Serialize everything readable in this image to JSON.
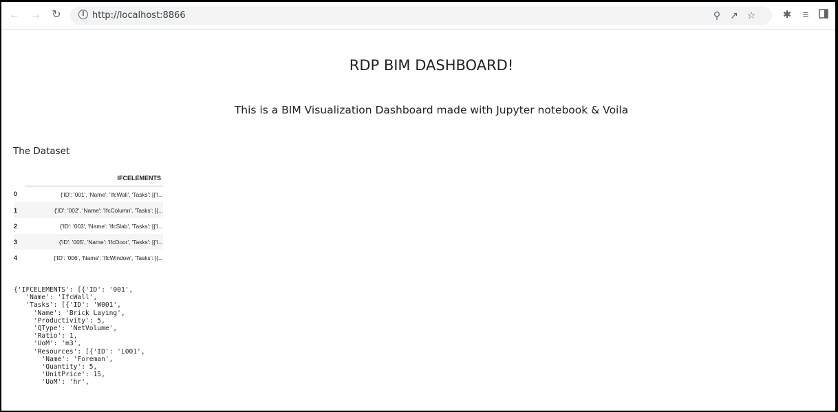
{
  "browser": {
    "url": "http://localhost:8866",
    "icons": {
      "back": "arrow-left-icon",
      "forward": "arrow-right-icon",
      "reload": "reload-icon",
      "site_info": "info-icon",
      "zoom": "zoom-icon",
      "share": "share-icon",
      "bookmark": "star-icon",
      "extensions": "puzzle-icon",
      "reading_list": "reading-list-icon",
      "side_panel": "side-panel-icon"
    }
  },
  "page": {
    "title": "RDP BIM DASHBOARD!",
    "subtitle": "This is a BIM Visualization Dashboard made with Jupyter notebook & Voila",
    "section_heading": "The Dataset",
    "table": {
      "column_header": "IFCELEMENTS",
      "rows": [
        {
          "index": "0",
          "value": "{'ID': '001', 'Name': 'IfcWall', 'Tasks': [{'I..."
        },
        {
          "index": "1",
          "value": "{'ID': '002', 'Name': 'IfcColumn', 'Tasks': [{..."
        },
        {
          "index": "2",
          "value": "{'ID': '003', 'Name': 'IfcSlab', 'Tasks': [{'I..."
        },
        {
          "index": "3",
          "value": "{'ID': '005', 'Name': 'IfcDoor', 'Tasks': [{'I..."
        },
        {
          "index": "4",
          "value": "{'ID': '006', 'Name': 'IfcWindow', 'Tasks': [{..."
        }
      ]
    },
    "json_output": [
      "{'IFCELEMENTS': [{'ID': '001',",
      "   'Name': 'IfcWall',",
      "   'Tasks': [{'ID': 'W001',",
      "     'Name': 'Brick Laying',",
      "     'Productivity': 5,",
      "     'QType': 'NetVolume',",
      "     'Ratio': 1,",
      "     'UoM': 'm3',",
      "     'Resources': [{'ID': 'L001',",
      "       'Name': 'Foreman',",
      "       'Quantity': 5,",
      "       'UnitPrice': 15,",
      "       'UoM': 'hr',"
    ]
  }
}
